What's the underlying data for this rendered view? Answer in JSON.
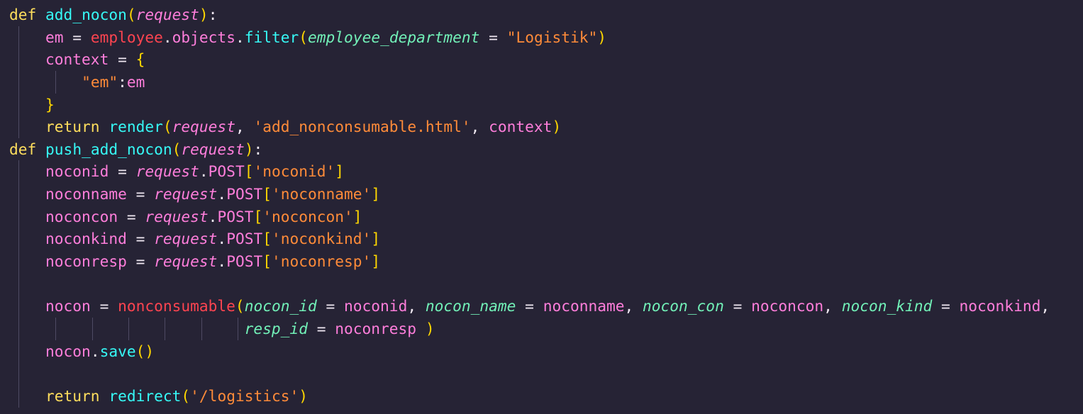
{
  "editor": {
    "language": "python",
    "theme_colors": {
      "background": "#262335",
      "keyword": "#fede5d",
      "function": "#36f9f6",
      "variable": "#ff7edb",
      "parameter": "#ff7edb",
      "argument_name": "#72f1b8",
      "class_name": "#fe4450",
      "string": "#ff8b39",
      "bracket_level1": "#ffd700",
      "bracket_level2": "#da70d6",
      "indent_guide": "#4e4a63"
    },
    "lines": [
      [
        {
          "t": "kw",
          "v": "def"
        },
        {
          "t": "plain",
          "v": " "
        },
        {
          "t": "fn",
          "v": "add_nocon"
        },
        {
          "t": "br1",
          "v": "("
        },
        {
          "t": "par",
          "v": "request"
        },
        {
          "t": "br1",
          "v": ")"
        },
        {
          "t": "op",
          "v": ":"
        }
      ],
      [
        {
          "t": "plain",
          "v": "    "
        },
        {
          "t": "var",
          "v": "em"
        },
        {
          "t": "op",
          "v": " = "
        },
        {
          "t": "cls",
          "v": "employee"
        },
        {
          "t": "op",
          "v": "."
        },
        {
          "t": "var",
          "v": "objects"
        },
        {
          "t": "op",
          "v": "."
        },
        {
          "t": "fn",
          "v": "filter"
        },
        {
          "t": "br1",
          "v": "("
        },
        {
          "t": "arg",
          "v": "employee_department"
        },
        {
          "t": "op",
          "v": " = "
        },
        {
          "t": "str",
          "v": "\"Logistik\""
        },
        {
          "t": "br1",
          "v": ")"
        }
      ],
      [
        {
          "t": "plain",
          "v": "    "
        },
        {
          "t": "var",
          "v": "context"
        },
        {
          "t": "op",
          "v": " = "
        },
        {
          "t": "br1",
          "v": "{"
        }
      ],
      [
        {
          "t": "plain",
          "v": "        "
        },
        {
          "t": "str",
          "v": "\"em\""
        },
        {
          "t": "op",
          "v": ":"
        },
        {
          "t": "var",
          "v": "em"
        }
      ],
      [
        {
          "t": "plain",
          "v": "    "
        },
        {
          "t": "br1",
          "v": "}"
        }
      ],
      [
        {
          "t": "plain",
          "v": "    "
        },
        {
          "t": "kw",
          "v": "return"
        },
        {
          "t": "plain",
          "v": " "
        },
        {
          "t": "fn",
          "v": "render"
        },
        {
          "t": "br1",
          "v": "("
        },
        {
          "t": "par",
          "v": "request"
        },
        {
          "t": "op",
          "v": ", "
        },
        {
          "t": "str",
          "v": "'add_nonconsumable.html'"
        },
        {
          "t": "op",
          "v": ", "
        },
        {
          "t": "var",
          "v": "context"
        },
        {
          "t": "br1",
          "v": ")"
        }
      ],
      [
        {
          "t": "kw",
          "v": "def"
        },
        {
          "t": "plain",
          "v": " "
        },
        {
          "t": "fn",
          "v": "push_add_nocon"
        },
        {
          "t": "br1",
          "v": "("
        },
        {
          "t": "par",
          "v": "request"
        },
        {
          "t": "br1",
          "v": ")"
        },
        {
          "t": "op",
          "v": ":"
        }
      ],
      [
        {
          "t": "plain",
          "v": "    "
        },
        {
          "t": "var",
          "v": "noconid"
        },
        {
          "t": "op",
          "v": " = "
        },
        {
          "t": "par",
          "v": "request"
        },
        {
          "t": "op",
          "v": "."
        },
        {
          "t": "var",
          "v": "POST"
        },
        {
          "t": "br1",
          "v": "["
        },
        {
          "t": "str",
          "v": "'noconid'"
        },
        {
          "t": "br1",
          "v": "]"
        }
      ],
      [
        {
          "t": "plain",
          "v": "    "
        },
        {
          "t": "var",
          "v": "noconname"
        },
        {
          "t": "op",
          "v": " = "
        },
        {
          "t": "par",
          "v": "request"
        },
        {
          "t": "op",
          "v": "."
        },
        {
          "t": "var",
          "v": "POST"
        },
        {
          "t": "br1",
          "v": "["
        },
        {
          "t": "str",
          "v": "'noconname'"
        },
        {
          "t": "br1",
          "v": "]"
        }
      ],
      [
        {
          "t": "plain",
          "v": "    "
        },
        {
          "t": "var",
          "v": "noconcon"
        },
        {
          "t": "op",
          "v": " = "
        },
        {
          "t": "par",
          "v": "request"
        },
        {
          "t": "op",
          "v": "."
        },
        {
          "t": "var",
          "v": "POST"
        },
        {
          "t": "br1",
          "v": "["
        },
        {
          "t": "str",
          "v": "'noconcon'"
        },
        {
          "t": "br1",
          "v": "]"
        }
      ],
      [
        {
          "t": "plain",
          "v": "    "
        },
        {
          "t": "var",
          "v": "noconkind"
        },
        {
          "t": "op",
          "v": " = "
        },
        {
          "t": "par",
          "v": "request"
        },
        {
          "t": "op",
          "v": "."
        },
        {
          "t": "var",
          "v": "POST"
        },
        {
          "t": "br1",
          "v": "["
        },
        {
          "t": "str",
          "v": "'noconkind'"
        },
        {
          "t": "br1",
          "v": "]"
        }
      ],
      [
        {
          "t": "plain",
          "v": "    "
        },
        {
          "t": "var",
          "v": "noconresp"
        },
        {
          "t": "op",
          "v": " = "
        },
        {
          "t": "par",
          "v": "request"
        },
        {
          "t": "op",
          "v": "."
        },
        {
          "t": "var",
          "v": "POST"
        },
        {
          "t": "br1",
          "v": "["
        },
        {
          "t": "str",
          "v": "'noconresp'"
        },
        {
          "t": "br1",
          "v": "]"
        }
      ],
      [],
      [
        {
          "t": "plain",
          "v": "    "
        },
        {
          "t": "var",
          "v": "nocon"
        },
        {
          "t": "op",
          "v": " = "
        },
        {
          "t": "cls",
          "v": "nonconsumable"
        },
        {
          "t": "br1",
          "v": "("
        },
        {
          "t": "arg",
          "v": "nocon_id"
        },
        {
          "t": "op",
          "v": " = "
        },
        {
          "t": "var",
          "v": "noconid"
        },
        {
          "t": "op",
          "v": ", "
        },
        {
          "t": "arg",
          "v": "nocon_name"
        },
        {
          "t": "op",
          "v": " = "
        },
        {
          "t": "var",
          "v": "noconname"
        },
        {
          "t": "op",
          "v": ", "
        },
        {
          "t": "arg",
          "v": "nocon_con"
        },
        {
          "t": "op",
          "v": " = "
        },
        {
          "t": "var",
          "v": "noconcon"
        },
        {
          "t": "op",
          "v": ", "
        },
        {
          "t": "arg",
          "v": "nocon_kind"
        },
        {
          "t": "op",
          "v": " = "
        },
        {
          "t": "var",
          "v": "noconkind"
        },
        {
          "t": "op",
          "v": ","
        }
      ],
      [
        {
          "t": "plain",
          "v": "                          "
        },
        {
          "t": "arg",
          "v": "resp_id"
        },
        {
          "t": "op",
          "v": " = "
        },
        {
          "t": "var",
          "v": "noconresp"
        },
        {
          "t": "op",
          "v": " "
        },
        {
          "t": "br1",
          "v": ")"
        }
      ],
      [
        {
          "t": "plain",
          "v": "    "
        },
        {
          "t": "var",
          "v": "nocon"
        },
        {
          "t": "op",
          "v": "."
        },
        {
          "t": "fn",
          "v": "save"
        },
        {
          "t": "br1",
          "v": "()"
        }
      ],
      [],
      [
        {
          "t": "plain",
          "v": "    "
        },
        {
          "t": "kw",
          "v": "return"
        },
        {
          "t": "plain",
          "v": " "
        },
        {
          "t": "fn",
          "v": "redirect"
        },
        {
          "t": "br1",
          "v": "("
        },
        {
          "t": "str",
          "v": "'/logistics'"
        },
        {
          "t": "br1",
          "v": ")"
        }
      ]
    ],
    "guides": [
      [],
      [
        "l1"
      ],
      [
        "l1"
      ],
      [
        "l1",
        "l2"
      ],
      [
        "l1"
      ],
      [
        "l1"
      ],
      [],
      [
        "l1"
      ],
      [
        "l1"
      ],
      [
        "l1"
      ],
      [
        "l1"
      ],
      [
        "l1"
      ],
      [
        "l1"
      ],
      [
        "l1"
      ],
      [
        "l1",
        "wl1",
        "wl2",
        "wl3",
        "wl4",
        "wl5",
        "wl6"
      ],
      [
        "l1"
      ],
      [
        "l1"
      ],
      [
        "l1"
      ]
    ]
  }
}
